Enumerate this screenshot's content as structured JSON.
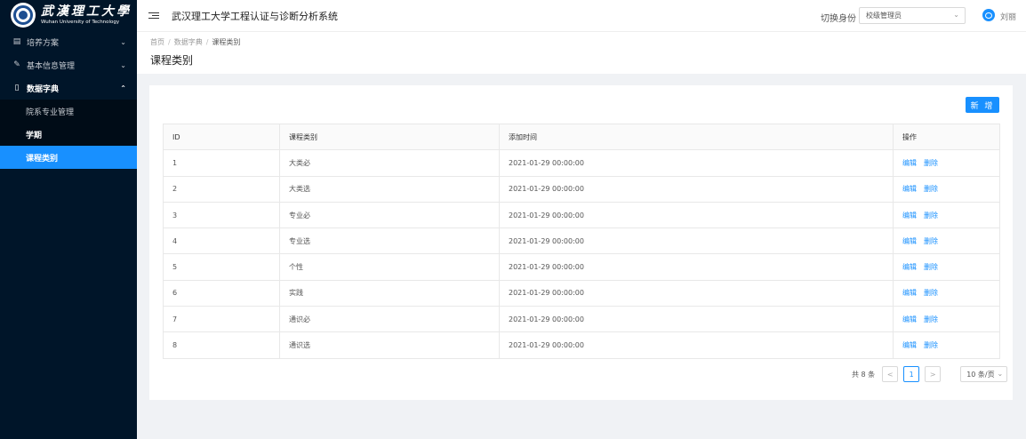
{
  "logo": {
    "cn": "武漢理工大學",
    "en": "Wuhan University of Technology"
  },
  "sidebar": {
    "items": [
      {
        "label": "培养方案",
        "icon": "document-icon",
        "chevron": "⌄"
      },
      {
        "label": "基本信息管理",
        "icon": "edit-icon",
        "chevron": "⌄"
      },
      {
        "label": "数据字典",
        "icon": "book-icon",
        "chevron": "⌃"
      }
    ],
    "sub_items": [
      {
        "label": "院系专业管理"
      },
      {
        "label": "学期"
      },
      {
        "label": "课程类别"
      }
    ]
  },
  "header": {
    "system_title": "武汉理工大学工程认证与诊断分析系统",
    "role_label": "切换身份",
    "role_value": "校级管理员",
    "user_name": "刘丽"
  },
  "breadcrumb": {
    "items": [
      "首页",
      "数据字典",
      "课程类别"
    ],
    "separator": "/"
  },
  "page_title": "课程类别",
  "toolbar": {
    "add_label": "新 增"
  },
  "table": {
    "columns": [
      "ID",
      "课程类别",
      "添加时间",
      "操作"
    ],
    "rows": [
      {
        "id": "1",
        "name": "大类必",
        "time": "2021-01-29 00:00:00"
      },
      {
        "id": "2",
        "name": "大类选",
        "time": "2021-01-29 00:00:00"
      },
      {
        "id": "3",
        "name": "专业必",
        "time": "2021-01-29 00:00:00"
      },
      {
        "id": "4",
        "name": "专业选",
        "time": "2021-01-29 00:00:00"
      },
      {
        "id": "5",
        "name": "个性",
        "time": "2021-01-29 00:00:00"
      },
      {
        "id": "6",
        "name": "实践",
        "time": "2021-01-29 00:00:00"
      },
      {
        "id": "7",
        "name": "通识必",
        "time": "2021-01-29 00:00:00"
      },
      {
        "id": "8",
        "name": "通识选",
        "time": "2021-01-29 00:00:00"
      }
    ],
    "actions": {
      "edit": "编辑",
      "delete": "删除"
    }
  },
  "pagination": {
    "total_text": "共 8 条",
    "prev": "<",
    "current": "1",
    "next": ">",
    "page_size": "10 条/页"
  },
  "colors": {
    "primary": "#1890ff",
    "sidebar_bg": "#001529",
    "submenu_bg": "#000c17"
  }
}
